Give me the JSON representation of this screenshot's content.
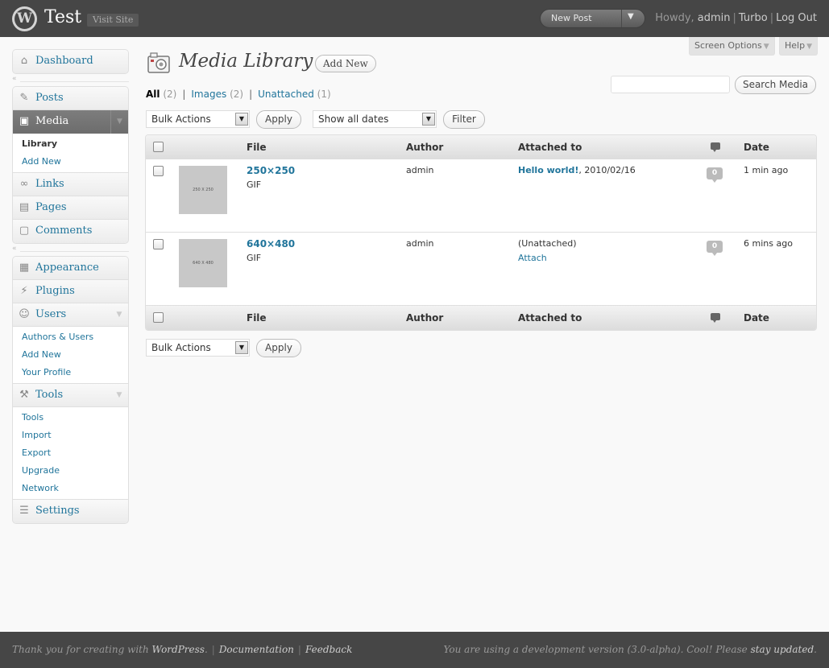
{
  "header": {
    "site_title": "Test",
    "visit_site": "Visit Site",
    "favorite_action": "New Post",
    "howdy": "Howdy, ",
    "username": "admin",
    "turbo": "Turbo",
    "logout": "Log Out"
  },
  "screen_options": {
    "label": "Screen Options",
    "help": "Help"
  },
  "menu": {
    "dashboard": "Dashboard",
    "posts": "Posts",
    "media": "Media",
    "media_sub": [
      "Library",
      "Add New"
    ],
    "links": "Links",
    "pages": "Pages",
    "comments": "Comments",
    "appearance": "Appearance",
    "plugins": "Plugins",
    "users": "Users",
    "users_sub": [
      "Authors & Users",
      "Add New",
      "Your Profile"
    ],
    "tools": "Tools",
    "tools_sub": [
      "Tools",
      "Import",
      "Export",
      "Upgrade",
      "Network"
    ],
    "settings": "Settings"
  },
  "page": {
    "title": "Media Library",
    "add_new": "Add New",
    "filters": {
      "all": "All",
      "all_count": "(2)",
      "images": "Images",
      "images_count": "(2)",
      "unattached": "Unattached",
      "unattached_count": "(1)"
    },
    "search_button": "Search Media",
    "bulk_actions": "Bulk Actions",
    "apply": "Apply",
    "show_all_dates": "Show all dates",
    "filter": "Filter"
  },
  "table": {
    "columns": {
      "file": "File",
      "author": "Author",
      "attached_to": "Attached to",
      "date": "Date"
    },
    "rows": [
      {
        "thumb": "250 X 250",
        "title": "250×250",
        "type": "GIF",
        "author": "admin",
        "attached_link": "Hello world!",
        "attached_date": ", 2010/02/16",
        "attach_action": "",
        "comments": "0",
        "date": "1 min ago"
      },
      {
        "thumb": "640 X 480",
        "title": "640×480",
        "type": "GIF",
        "author": "admin",
        "attached_link": "",
        "attached_date": "(Unattached)",
        "attach_action": "Attach",
        "comments": "0",
        "date": "6 mins ago"
      }
    ]
  },
  "footer": {
    "thanks": "Thank you for creating with ",
    "wordpress": "WordPress",
    "documentation": "Documentation",
    "feedback": "Feedback",
    "version_text": "You are using a development version (3.0-alpha). Cool! Please ",
    "stay_updated": "stay updated"
  }
}
